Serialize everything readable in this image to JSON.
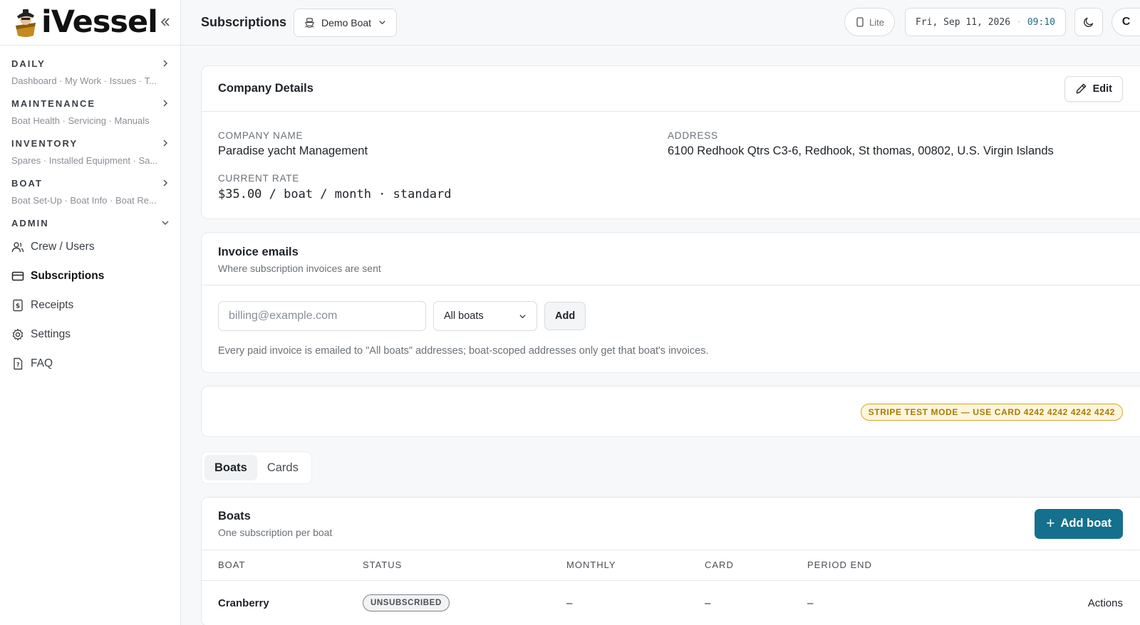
{
  "app": {
    "name": "iVessel"
  },
  "sidebar": {
    "sections": [
      {
        "label": "DAILY",
        "sub": "Dashboard · My Work · Issues · T..."
      },
      {
        "label": "MAINTENANCE",
        "sub": "Boat Health · Servicing · Manuals"
      },
      {
        "label": "INVENTORY",
        "sub": "Spares · Installed Equipment · Sa..."
      },
      {
        "label": "BOAT",
        "sub": "Boat Set-Up · Boat Info · Boat Re..."
      }
    ],
    "admin": {
      "label": "ADMIN",
      "items": [
        {
          "label": "Crew / Users",
          "icon": "users-icon"
        },
        {
          "label": "Subscriptions",
          "icon": "credit-card-icon",
          "active": true
        },
        {
          "label": "Receipts",
          "icon": "receipt-icon"
        },
        {
          "label": "Settings",
          "icon": "gear-icon"
        },
        {
          "label": "FAQ",
          "icon": "faq-icon"
        }
      ]
    }
  },
  "header": {
    "title": "Subscriptions",
    "boat_selector": "Demo Boat",
    "mode": "Lite",
    "date": "Fri, Sep 11, 2026",
    "time": "09:10",
    "avatar_initial": "C"
  },
  "company": {
    "title": "Company Details",
    "edit_label": "Edit",
    "name_label": "COMPANY NAME",
    "name": "Paradise yacht Management",
    "address_label": "ADDRESS",
    "address": "6100 Redhook Qtrs C3-6, Redhook, St thomas, 00802, U.S. Virgin Islands",
    "rate_label": "CURRENT RATE",
    "rate": "$35.00 / boat / month · standard"
  },
  "invoice_emails": {
    "title": "Invoice emails",
    "subtitle": "Where subscription invoices are sent",
    "email_placeholder": "billing@example.com",
    "scope_value": "All boats",
    "add_label": "Add",
    "note": "Every paid invoice is emailed to \"All boats\" addresses; boat-scoped addresses only get that boat's invoices."
  },
  "stripe": {
    "badge": "STRIPE TEST MODE — USE CARD 4242 4242 4242 4242"
  },
  "tabs": [
    {
      "label": "Boats",
      "active": true
    },
    {
      "label": "Cards"
    }
  ],
  "boats": {
    "title": "Boats",
    "subtitle": "One subscription per boat",
    "add_label": "Add boat",
    "columns": [
      "BOAT",
      "STATUS",
      "MONTHLY",
      "CARD",
      "PERIOD END"
    ],
    "rows": [
      {
        "boat": "Cranberry",
        "status": "UNSUBSCRIBED",
        "monthly": "–",
        "card": "–",
        "period_end": "–",
        "actions": "Actions"
      }
    ]
  },
  "colors": {
    "primary": "#14708c",
    "stripe_badge_border": "#d9a520",
    "stripe_badge_text": "#a77b05",
    "time_text": "#1d6f85"
  }
}
